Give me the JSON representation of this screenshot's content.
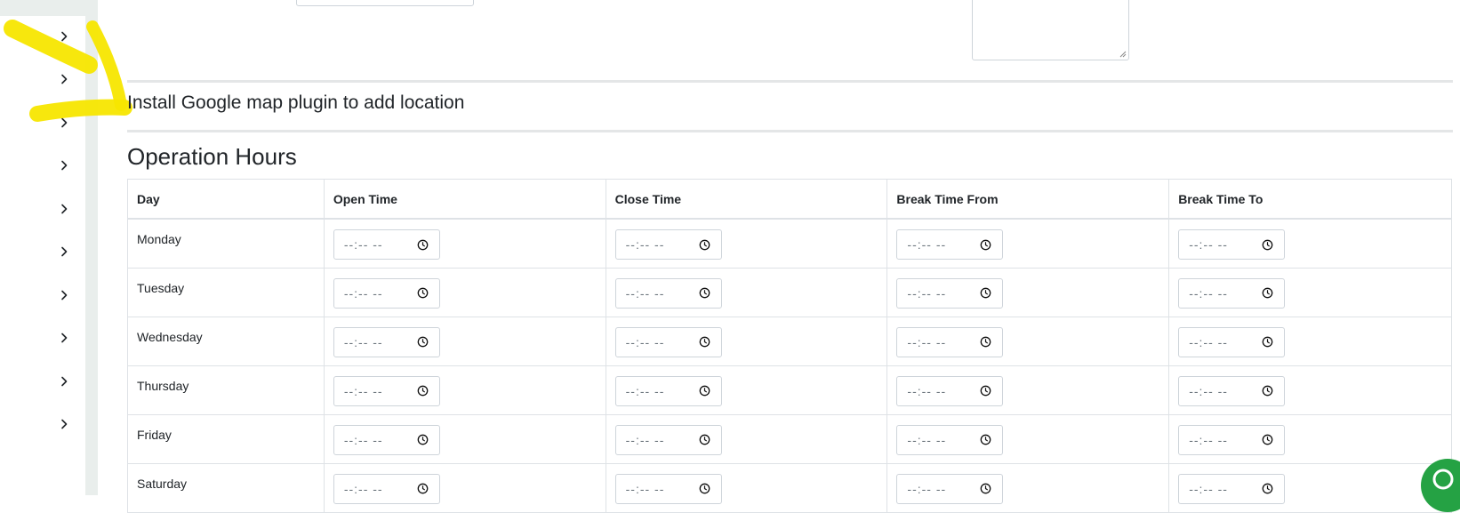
{
  "location": {
    "plugin_note": "Install Google map plugin to add location"
  },
  "operation_hours": {
    "title": "Operation Hours",
    "columns": [
      "Day",
      "Open Time",
      "Close Time",
      "Break Time From",
      "Break Time To"
    ],
    "time_placeholder": "--:-- --",
    "rows": [
      {
        "day": "Monday"
      },
      {
        "day": "Tuesday"
      },
      {
        "day": "Wednesday"
      },
      {
        "day": "Thursday"
      },
      {
        "day": "Friday"
      },
      {
        "day": "Saturday"
      }
    ]
  },
  "icons": {
    "sidebar_chevron": "chevron-right-icon",
    "time_picker": "clock-icon",
    "chat": "chat-icon"
  },
  "colors": {
    "highlighter": "#f7e600",
    "sidebar_strip": "#e9eeec",
    "chat_bubble": "#25a244"
  }
}
